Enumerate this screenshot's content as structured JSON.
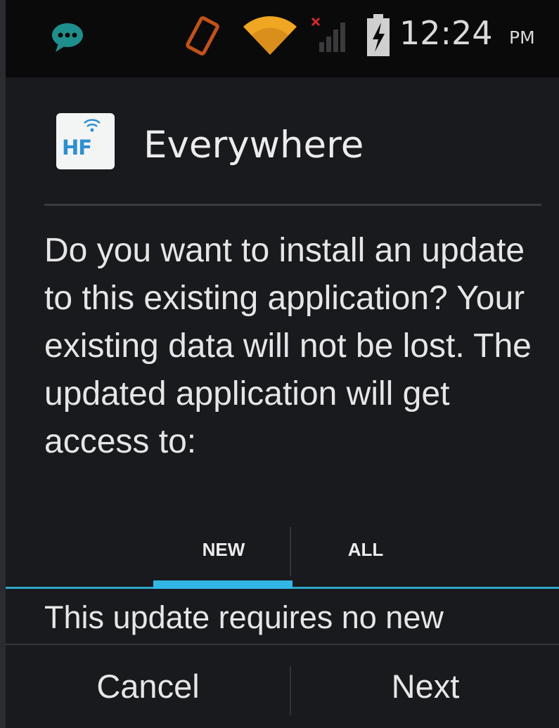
{
  "status_bar": {
    "icons": [
      "chat-notification-icon",
      "rotation-icon",
      "wifi-icon",
      "no-signal-icon",
      "battery-charging-icon"
    ],
    "time": "12:24",
    "ampm": "PM"
  },
  "dialog": {
    "app_icon_label": "HF",
    "app_name": "Everywhere",
    "message": "Do you want to install an update to this existing application? Your existing data will not be lost. The updated application will get access to:",
    "tabs": [
      {
        "label": "NEW",
        "selected": true
      },
      {
        "label": "ALL",
        "selected": false
      }
    ],
    "permissions_text": "This update requires no new",
    "buttons": {
      "cancel": "Cancel",
      "next": "Next"
    }
  },
  "colors": {
    "accent": "#33b5e5",
    "background": "#191a1d",
    "status_bar": "#0a0a0b",
    "text": "#e6e6e6",
    "chat_icon": "#1f8f8d",
    "wifi_icon": "#f0a623",
    "rotation_icon": "#c2521b",
    "no_signal_x": "#d12a2a"
  }
}
